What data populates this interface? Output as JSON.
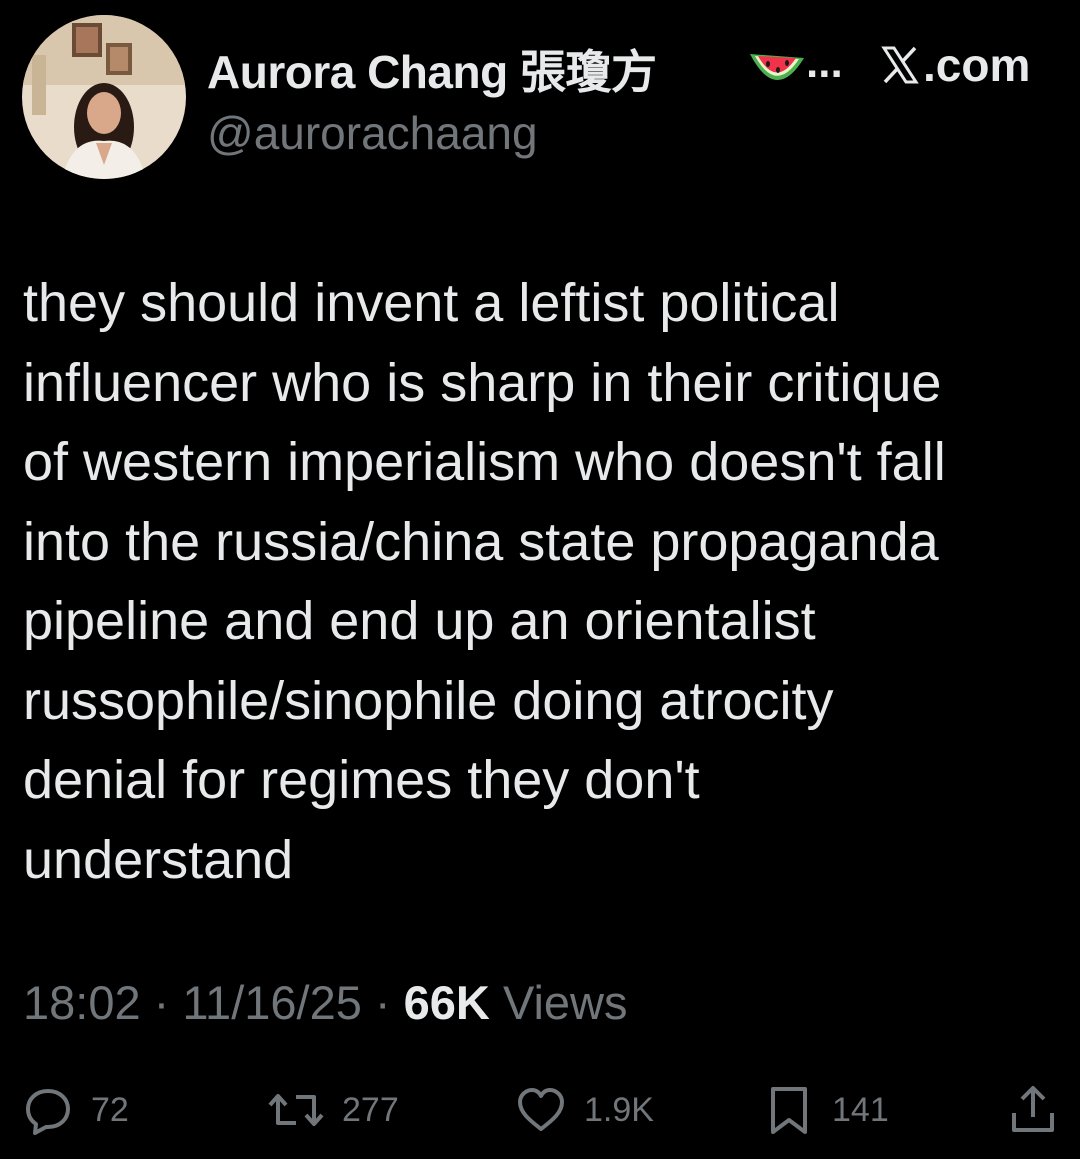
{
  "author": {
    "display_name": "Aurora Chang 張瓊方",
    "name_ellipsis": "...",
    "handle": "@aurorachaang",
    "emoji": "watermelon-icon"
  },
  "source": {
    "label": ".com",
    "logo": "x-logo-icon"
  },
  "tweet": {
    "lines": [
      "they should invent a leftist political",
      "influencer who is sharp in their critique",
      "of western imperialism who doesn't fall",
      "into the russia/china state propaganda",
      "pipeline and end up an orientalist",
      "russophile/sinophile doing atrocity",
      "denial for regimes they don't",
      "understand"
    ]
  },
  "meta": {
    "time": "18:02",
    "separator": " · ",
    "date": "11/16/25",
    "views_count": "66K",
    "views_label": "Views"
  },
  "actions": {
    "replies": "72",
    "reposts": "277",
    "likes": "1.9K",
    "bookmarks": "141"
  },
  "colors": {
    "background": "#000000",
    "text": "#e7e9ea",
    "secondary": "#71767b"
  }
}
